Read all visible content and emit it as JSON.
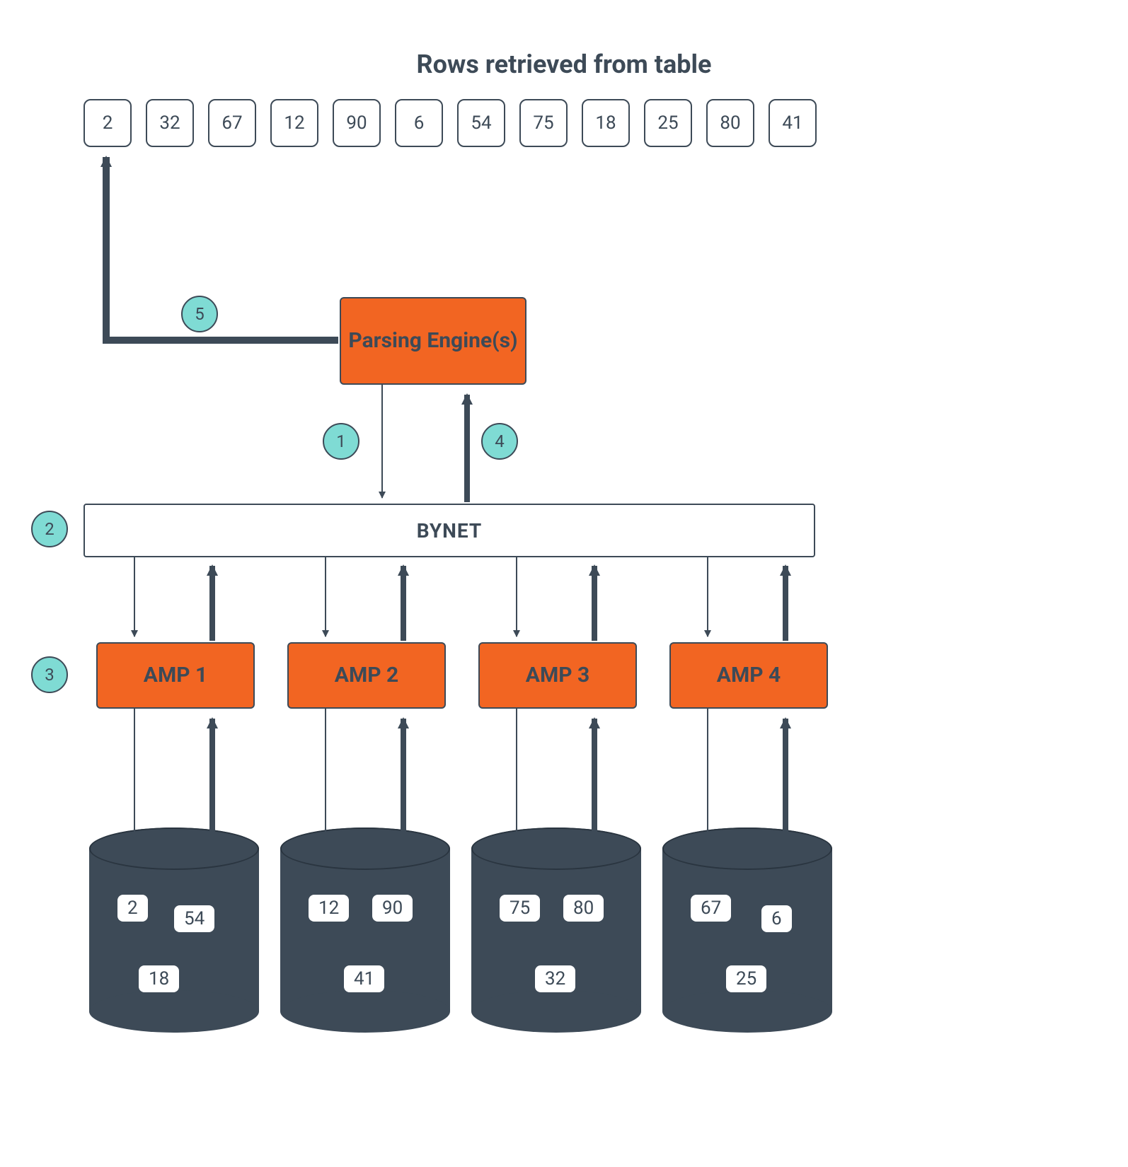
{
  "title": "Rows retrieved from table",
  "rows": [
    "2",
    "32",
    "67",
    "12",
    "90",
    "6",
    "54",
    "75",
    "18",
    "25",
    "80",
    "41"
  ],
  "parsing_engine_label": "Parsing Engine(s)",
  "bynet_label": "BYNET",
  "amps": {
    "amp1": "AMP 1",
    "amp2": "AMP 2",
    "amp3": "AMP 3",
    "amp4": "AMP 4"
  },
  "steps": {
    "s1": "1",
    "s2": "2",
    "s3": "3",
    "s4": "4",
    "s5": "5"
  },
  "storage": {
    "d1": [
      "2",
      "54",
      "18"
    ],
    "d2": [
      "12",
      "90",
      "41"
    ],
    "d3": [
      "75",
      "80",
      "32"
    ],
    "d4": [
      "67",
      "6",
      "25"
    ]
  },
  "colors": {
    "accent": "#f26522",
    "step": "#7fdbd4",
    "dark": "#3d4a57"
  }
}
